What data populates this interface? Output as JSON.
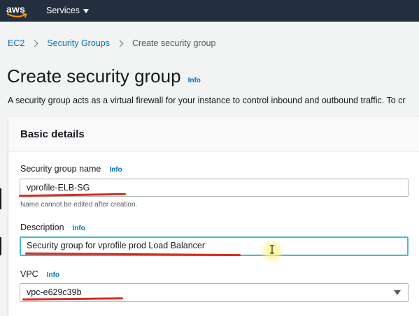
{
  "topbar": {
    "logo_text": "aws",
    "services_label": "Services"
  },
  "breadcrumb": {
    "items": [
      "EC2",
      "Security Groups"
    ],
    "current": "Create security group"
  },
  "page": {
    "title": "Create security group",
    "info": "Info",
    "description": "A security group acts as a virtual firewall for your instance to control inbound and outbound traffic. To cr"
  },
  "basic_details": {
    "title": "Basic details",
    "name": {
      "label": "Security group name",
      "info": "Info",
      "value": "vprofile-ELB-SG",
      "hint": "Name cannot be edited after creation."
    },
    "description": {
      "label": "Description",
      "info": "Info",
      "value": "Security group for vprofile prod Load Balancer"
    },
    "vpc": {
      "label": "VPC",
      "info": "Info",
      "value": "vpc-e629c39b"
    }
  },
  "colors": {
    "topbar": "#232f3e",
    "link": "#0073bb",
    "focus_border": "#44b9d6",
    "annotation": "#d62d20"
  }
}
